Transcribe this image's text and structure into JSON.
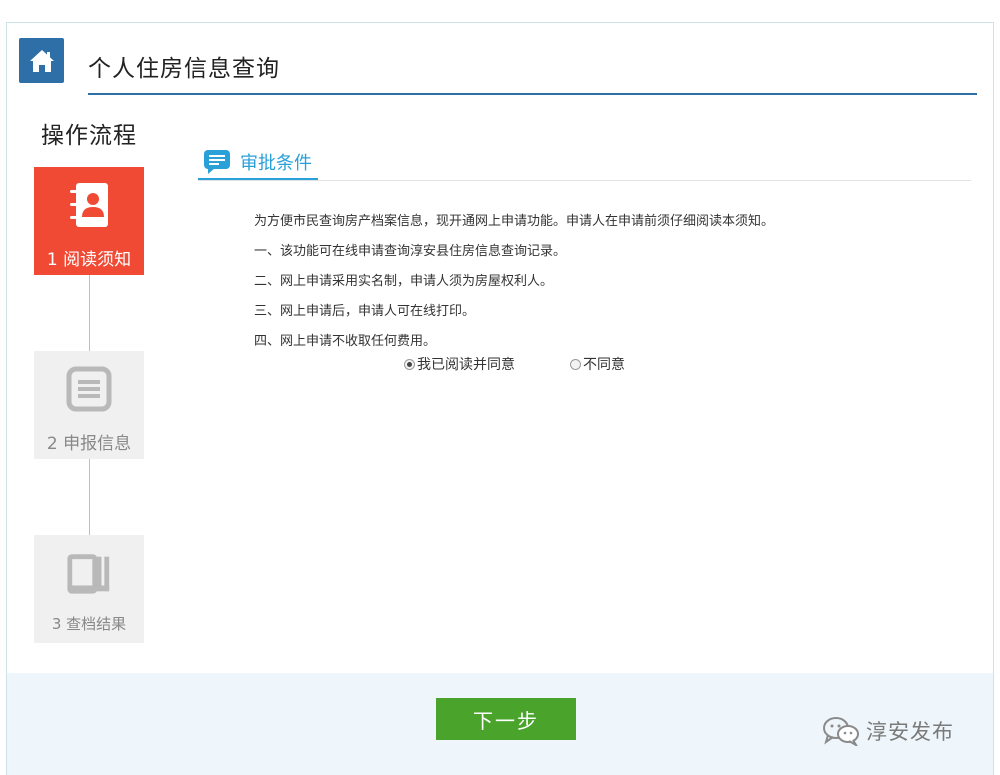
{
  "header": {
    "title": "个人住房信息查询"
  },
  "sidebar": {
    "title": "操作流程",
    "steps": [
      {
        "label": "1 阅读须知",
        "state": "active"
      },
      {
        "label": "2 申报信息",
        "state": "inactive"
      },
      {
        "label": "3  查档结果",
        "state": "inactive"
      }
    ]
  },
  "section": {
    "title": "审批条件"
  },
  "notice": {
    "lines": [
      "为方便市民查询房产档案信息，现开通网上申请功能。申请人在申请前须仔细阅读本须知。",
      "一、该功能可在线申请查询淳安县住房信息查询记录。",
      "二、网上申请采用实名制，申请人须为房屋权利人。",
      "三、网上申请后，申请人可在线打印。",
      "四、网上申请不收取任何费用。"
    ]
  },
  "agreement": {
    "agree_label": "我已阅读并同意",
    "disagree_label": "不同意",
    "selected": "agree"
  },
  "footer": {
    "next_label": "下一步",
    "brand": "淳安发布"
  },
  "colors": {
    "header_accent": "#2f6fa8",
    "active_step": "#f04a34",
    "section_accent": "#29a0d8",
    "next_button": "#4aa42c"
  },
  "icons": {
    "home": "home-icon",
    "step1": "contact-book-icon",
    "step2": "document-list-icon",
    "step3": "books-icon",
    "section": "chat-message-icon",
    "brand": "wechat-icon"
  }
}
